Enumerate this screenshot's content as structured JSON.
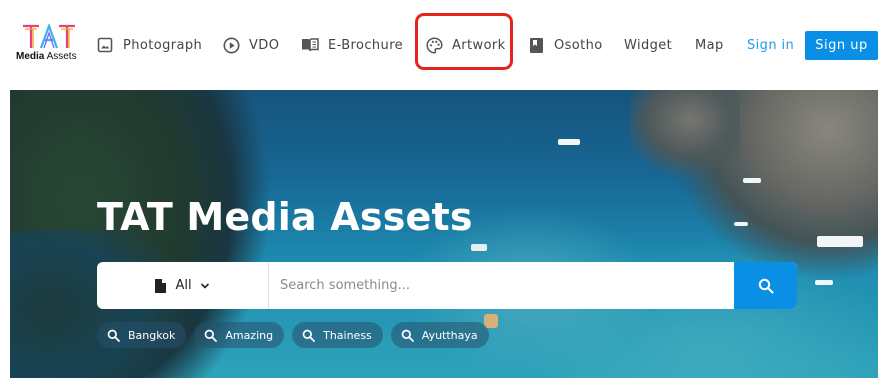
{
  "brand": {
    "logo_mark": "TAT",
    "logo_bold": "Media",
    "logo_rest": " Assets",
    "colors": [
      "#e8407a",
      "#f5a623",
      "#3bb3e8",
      "#7b61ff"
    ]
  },
  "nav": {
    "items": [
      {
        "label": "Photograph",
        "icon": "image-icon"
      },
      {
        "label": "VDO",
        "icon": "play-circle-icon"
      },
      {
        "label": "E-Brochure",
        "icon": "book-open-icon"
      },
      {
        "label": "Artwork",
        "icon": "palette-icon"
      },
      {
        "label": "Osotho",
        "icon": "bookmark-book-icon"
      },
      {
        "label": "Widget"
      },
      {
        "label": "Map"
      }
    ],
    "sign_in": "Sign in",
    "sign_up": "Sign up",
    "highlighted": "Artwork",
    "highlight_color": "#e5251b",
    "accent": "#0a8fe6"
  },
  "hero": {
    "title": "TAT Media Assets",
    "search": {
      "category": "All",
      "placeholder": "Search something..."
    },
    "tags": [
      "Bangkok",
      "Amazing",
      "Thainess",
      "Ayutthaya"
    ]
  }
}
